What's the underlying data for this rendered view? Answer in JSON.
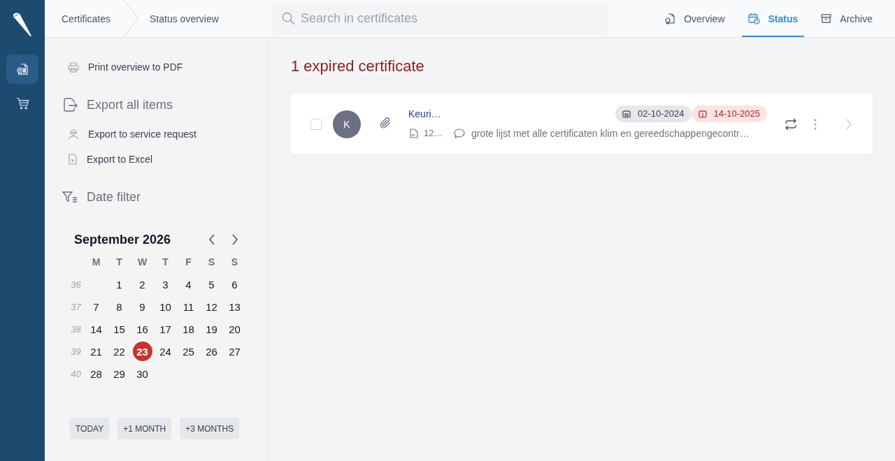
{
  "nav_rail": {
    "items": [
      {
        "selected": true
      },
      {
        "selected": false
      }
    ]
  },
  "breadcrumb": [
    "Certificates",
    "Status overview"
  ],
  "search": {
    "placeholder": "Search in certificates"
  },
  "tabs": [
    {
      "label": "Overview",
      "selected": false
    },
    {
      "label": "Status",
      "selected": true
    },
    {
      "label": "Archive",
      "selected": false
    }
  ],
  "sidebar": {
    "print_link": "Print overview to PDF",
    "export": {
      "title": "Export all items",
      "links": [
        "Export to service request",
        "Export to Excel"
      ]
    },
    "date_filter": {
      "title": "Date filter",
      "calendar": {
        "month": "September 2026",
        "weekdays": [
          "M",
          "T",
          "W",
          "T",
          "F",
          "S",
          "S"
        ],
        "weeks": [
          {
            "number": "36",
            "days": [
              {
                "day": "1",
                "selected": false
              },
              {
                "day": "2",
                "selected": false
              },
              {
                "day": "3",
                "selected": false
              },
              {
                "day": "4",
                "selected": false
              },
              {
                "day": "5",
                "selected": false
              },
              {
                "day": "6",
                "selected": false
              }
            ]
          },
          {
            "number": "37",
            "days": [
              {
                "day": "7",
                "selected": false
              },
              {
                "day": "8",
                "selected": false
              },
              {
                "day": "9",
                "selected": false
              },
              {
                "day": "10",
                "selected": false
              },
              {
                "day": "11",
                "selected": false
              },
              {
                "day": "12",
                "selected": false
              },
              {
                "day": "13",
                "selected": false
              }
            ]
          },
          {
            "number": "38",
            "days": [
              {
                "day": "14",
                "selected": false
              },
              {
                "day": "15",
                "selected": false
              },
              {
                "day": "16",
                "selected": false
              },
              {
                "day": "17",
                "selected": false
              },
              {
                "day": "18",
                "selected": false
              },
              {
                "day": "19",
                "selected": false
              },
              {
                "day": "20",
                "selected": false
              }
            ]
          },
          {
            "number": "39",
            "days": [
              {
                "day": "21",
                "selected": false
              },
              {
                "day": "22",
                "selected": false
              },
              {
                "day": "23",
                "selected": true
              },
              {
                "day": "24",
                "selected": false
              },
              {
                "day": "25",
                "selected": false
              },
              {
                "day": "26",
                "selected": false
              },
              {
                "day": "27",
                "selected": false
              }
            ]
          },
          {
            "number": "40",
            "days": [
              {
                "day": "28",
                "selected": false
              },
              {
                "day": "29",
                "selected": false
              },
              {
                "day": "30",
                "selected": false
              }
            ]
          }
        ]
      },
      "quick_ranges": [
        "TODAY",
        "+1 MONTH",
        "+3 MONTHS"
      ]
    }
  },
  "main": {
    "heading": "1 expired certificate",
    "certificates": [
      {
        "checked": false,
        "avatar": "K",
        "title": "Keuri…",
        "file": "12…",
        "comment": "grote lijst met alle certificaten klim en gereedschappengecontr…",
        "dates": [
          {
            "kind": "issued",
            "label": "02-10-2024"
          },
          {
            "kind": "expired",
            "label": "14-10-2025"
          }
        ]
      }
    ]
  }
}
